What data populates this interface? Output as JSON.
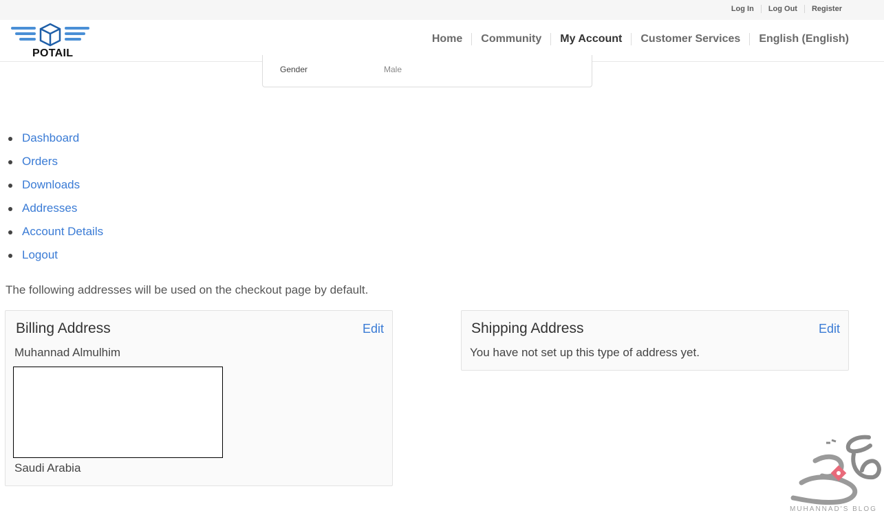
{
  "topbar": {
    "links": [
      "Log In",
      "Log Out",
      "Register"
    ]
  },
  "header": {
    "logo_text": "POTAIL",
    "logo_icon": "box-wings-logo-icon",
    "nav": [
      "Home",
      "Community",
      "My Account",
      "Customer Services",
      "English (English)"
    ],
    "active_nav": "My Account"
  },
  "profile": {
    "field_label": "Gender",
    "field_value": "Male"
  },
  "account_menu": [
    "Dashboard",
    "Orders",
    "Downloads",
    "Addresses",
    "Account Details",
    "Logout"
  ],
  "intro": "The following addresses will be used on the checkout page by default.",
  "billing": {
    "title": "Billing Address",
    "edit_label": "Edit",
    "name": "Muhannad Almulhim",
    "country": "Saudi Arabia"
  },
  "shipping": {
    "title": "Shipping Address",
    "edit_label": "Edit",
    "message": "You have not set up this type of address yet."
  },
  "watermark": {
    "text": "MUHANNAD'S BLOG"
  },
  "colors": {
    "link": "#3a7bd5",
    "logo_blue": "#4a8fd6",
    "topbar_bg": "#f6f6f6",
    "box_bg": "#fafafa"
  }
}
